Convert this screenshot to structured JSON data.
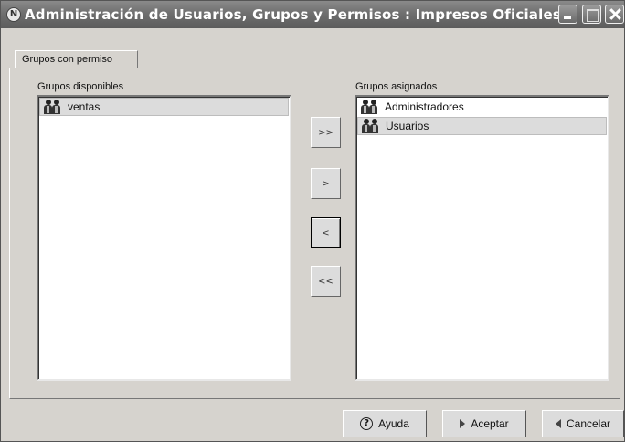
{
  "window": {
    "title": "Administración de Usuarios, Grupos y Permisos : Impresos Oficiales",
    "app_icon_glyph": "N"
  },
  "tabs": [
    {
      "label": "Grupos con permiso"
    }
  ],
  "available": {
    "label": "Grupos disponibles",
    "items": [
      {
        "label": "ventas",
        "icon": "group-icon",
        "selected": true
      }
    ]
  },
  "assigned": {
    "label": "Grupos asignados",
    "items": [
      {
        "label": "Administradores",
        "icon": "group-icon",
        "selected": false
      },
      {
        "label": "Usuarios",
        "icon": "group-icon",
        "selected": true
      }
    ]
  },
  "transfer": {
    "add_all": ">>",
    "add": ">",
    "remove": "<",
    "remove_all": "<<"
  },
  "buttons": {
    "help": {
      "label": "Ayuda",
      "icon": "help-icon"
    },
    "accept": {
      "label": "Aceptar",
      "icon": "play-right-icon"
    },
    "cancel": {
      "label": "Cancelar",
      "icon": "play-left-icon"
    }
  }
}
